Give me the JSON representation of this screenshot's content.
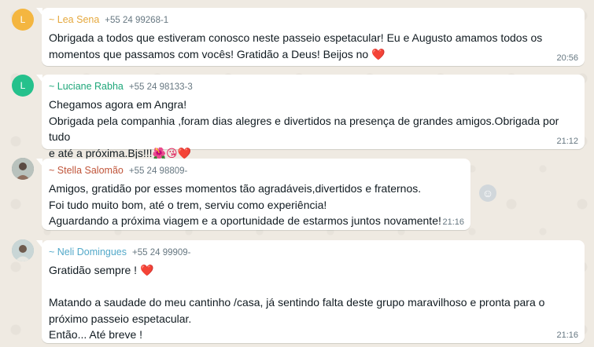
{
  "messages": [
    {
      "avatar_letter": "L",
      "avatar_color": "#f4b640",
      "sender": "~ Lea Sena",
      "sender_color": "#e5a83d",
      "phone": "+55 24 99268-1",
      "lines": [
        "Obrigada a todos que estiveram conosco neste passeio espetacular! Eu e Augusto amamos todos os",
        "momentos que passamos com vocês! Gratidão a Deus! Beijos no "
      ],
      "emoji": "❤️",
      "time": "20:56"
    },
    {
      "avatar_letter": "L",
      "avatar_color": "#25c18c",
      "sender": "~ Luciane Rabha",
      "sender_color": "#1fa77a",
      "phone": "+55 24 98133-3",
      "lines": [
        "Chegamos agora em Angra!",
        "Obrigada pela companhia ,foram dias alegres e divertidos na presença de grandes amigos.Obrigada por tudo",
        "e até a próxima.Bjs!!!"
      ],
      "emoji": "🌺😘❤️",
      "time": "21:12"
    },
    {
      "avatar_letter": "",
      "avatar_color": "#7a8a8c",
      "sender": "~ Stella Salomão",
      "sender_color": "#c0553a",
      "phone": "+55 24 98809-",
      "lines": [
        "Amigos, gratidão por esses momentos tão agradáveis,divertidos e fraternos.",
        "Foi tudo muito bom, até o trem, serviu como experiência!",
        "Aguardando a próxima viagem e a oportunidade de estarmos juntos novamente!"
      ],
      "emoji": "",
      "time": "21:16"
    },
    {
      "avatar_letter": "",
      "avatar_color": "#9fb3b8",
      "sender": "~ Neli Domingues",
      "sender_color": "#53a9c9",
      "phone": "+55 24 99909-",
      "lines": [
        "Gratidão sempre ! ",
        "",
        "Matando a saudade do meu cantinho /casa, já sentindo falta deste grupo maravilhoso e pronta para o",
        "próximo passeio espetacular.",
        "Então... Até breve !"
      ],
      "emoji": "❤️",
      "time": "21:16"
    }
  ],
  "react_icon": "smiley-icon"
}
